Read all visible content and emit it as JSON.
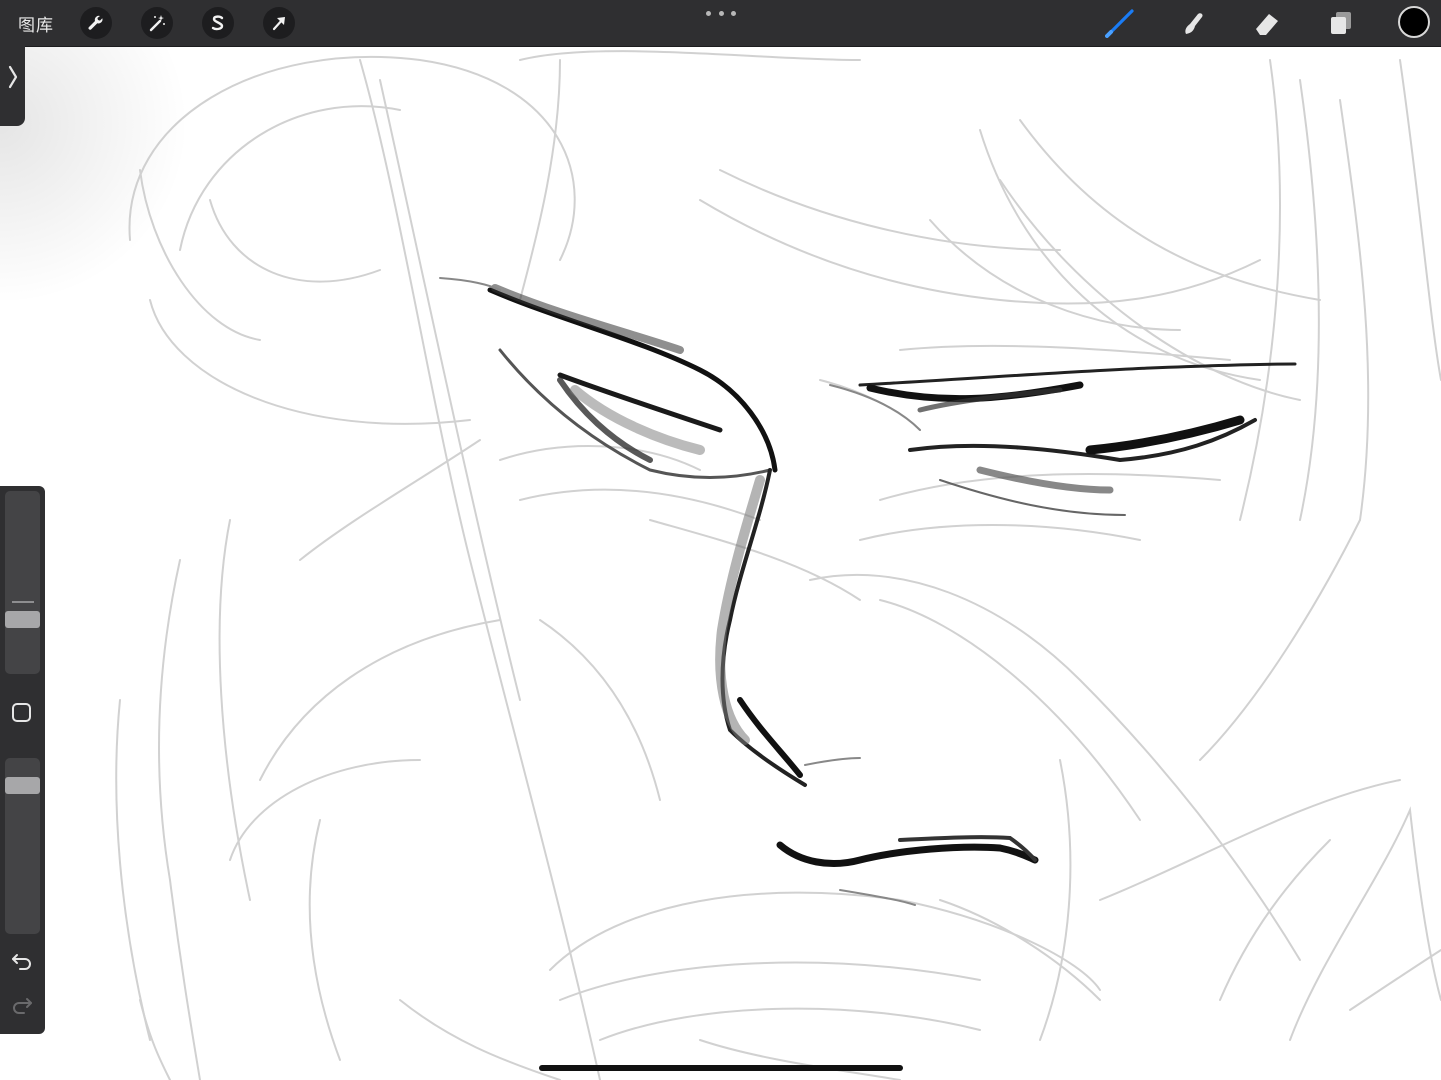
{
  "toolbar": {
    "gallery_label": "图库",
    "left_tools": [
      "wrench-icon",
      "magic-wand-icon",
      "selection-s-icon",
      "transform-arrow-icon"
    ],
    "right_tools": [
      "brush-icon",
      "smudge-icon",
      "eraser-icon",
      "layers-icon"
    ],
    "active_tool": "brush",
    "active_tool_color": "#1a7cf5",
    "current_color": "#000000"
  },
  "sidebar": {
    "brush_size_level": 0.28,
    "brush_opacity_level": 0.88,
    "buttons": [
      "modify-square-icon",
      "undo-icon",
      "redo-icon"
    ]
  },
  "canvas": {
    "background": "#ffffff",
    "content": "pencil sketch"
  }
}
